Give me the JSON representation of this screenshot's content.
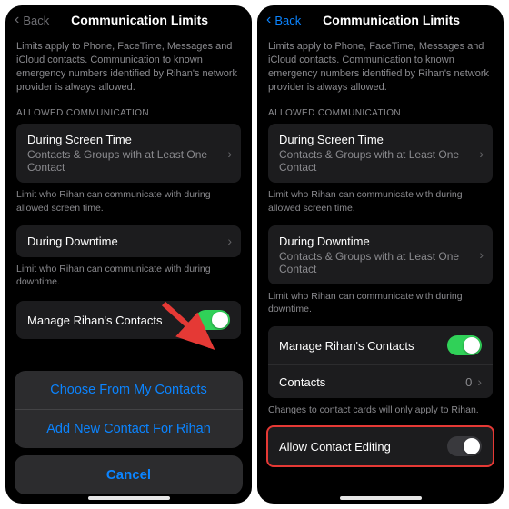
{
  "left": {
    "nav": {
      "back": "Back",
      "title": "Communication Limits"
    },
    "intro": "Limits apply to Phone, FaceTime, Messages and iCloud contacts. Communication to known emergency numbers identified by Rihan's network provider is always allowed.",
    "section_header": "ALLOWED COMMUNICATION",
    "during_screen": {
      "title": "During Screen Time",
      "subtitle": "Contacts & Groups with at Least One Contact",
      "footer": "Limit who Rihan can communicate with during allowed screen time."
    },
    "during_down": {
      "title": "During Downtime",
      "footer": "Limit who Rihan can communicate with during downtime."
    },
    "manage_row": {
      "label": "Manage Rihan's Contacts"
    },
    "sheet": {
      "opt1": "Choose From My Contacts",
      "opt2": "Add New Contact For Rihan",
      "cancel": "Cancel"
    }
  },
  "right": {
    "nav": {
      "back": "Back",
      "title": "Communication Limits"
    },
    "intro": "Limits apply to Phone, FaceTime, Messages and iCloud contacts. Communication to known emergency numbers identified by Rihan's network provider is always allowed.",
    "section_header": "ALLOWED COMMUNICATION",
    "during_screen": {
      "title": "During Screen Time",
      "subtitle": "Contacts & Groups with at Least One Contact",
      "footer": "Limit who Rihan can communicate with during allowed screen time."
    },
    "during_down": {
      "title": "During Downtime",
      "subtitle": "Contacts & Groups with at Least One Contact",
      "footer": "Limit who Rihan can communicate with during downtime."
    },
    "manage_row": {
      "label": "Manage Rihan's Contacts"
    },
    "contacts_row": {
      "label": "Contacts",
      "value": "0"
    },
    "contacts_footer": "Changes to contact cards will only apply to Rihan.",
    "allow_edit": {
      "label": "Allow Contact Editing"
    }
  }
}
